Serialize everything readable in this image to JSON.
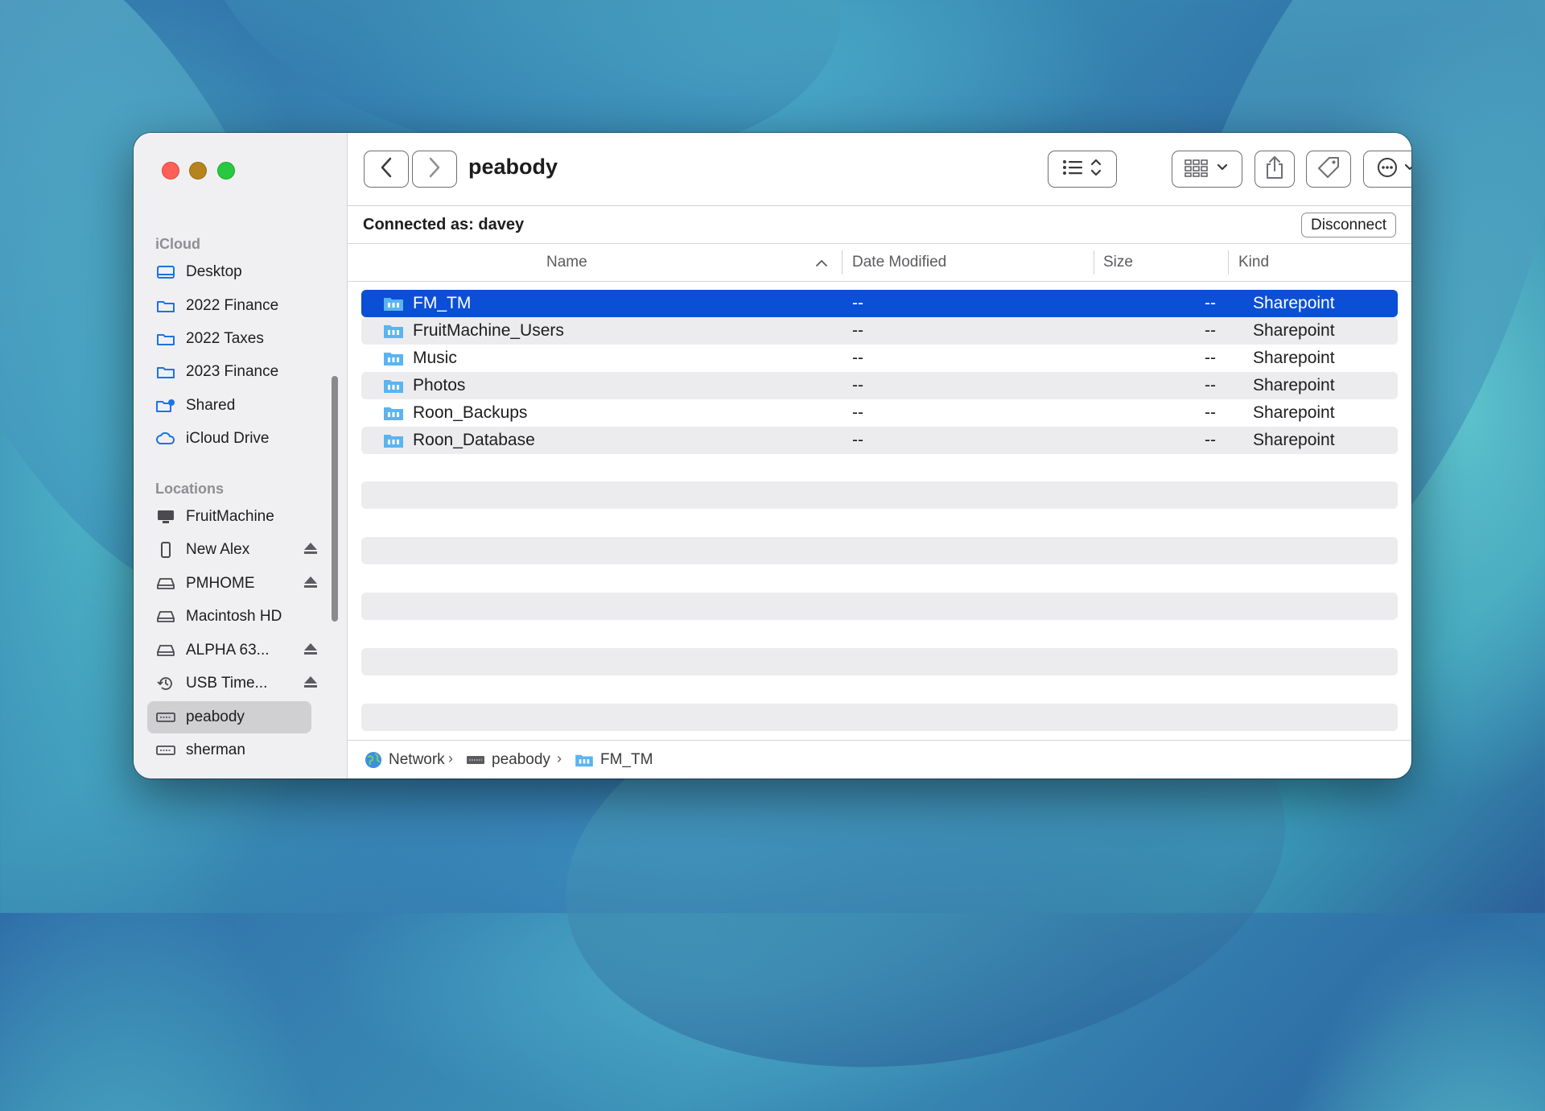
{
  "window": {
    "title": "peabody"
  },
  "sidebar": {
    "icloud_header": "iCloud",
    "icloud_items": [
      {
        "label": "Desktop",
        "icon": "desktop-icon"
      },
      {
        "label": "2022 Finance",
        "icon": "folder-icon"
      },
      {
        "label": "2022 Taxes",
        "icon": "folder-icon"
      },
      {
        "label": "2023 Finance",
        "icon": "folder-icon"
      },
      {
        "label": "Shared",
        "icon": "shared-folder-icon"
      },
      {
        "label": "iCloud Drive",
        "icon": "cloud-icon"
      }
    ],
    "locations_header": "Locations",
    "location_items": [
      {
        "label": "FruitMachine",
        "icon": "computer-icon",
        "eject": false
      },
      {
        "label": "New Alex",
        "icon": "phone-icon",
        "eject": true
      },
      {
        "label": "PMHOME",
        "icon": "drive-icon",
        "eject": true
      },
      {
        "label": "Macintosh HD",
        "icon": "drive-icon",
        "eject": false
      },
      {
        "label": "ALPHA 63...",
        "icon": "drive-icon",
        "eject": true
      },
      {
        "label": "USB Time...",
        "icon": "time-machine-icon",
        "eject": true
      },
      {
        "label": "peabody",
        "icon": "server-icon",
        "eject": false,
        "selected": true
      },
      {
        "label": "sherman",
        "icon": "server-icon",
        "eject": false
      }
    ]
  },
  "toolbar": {
    "back": "back-chevron-icon",
    "forward": "forward-chevron-icon",
    "view_mode": "list-view-icon",
    "group": "group-grid-icon",
    "share": "share-icon",
    "tag": "tag-icon",
    "more": "ellipsis-circle-icon",
    "search": "search-icon"
  },
  "connection": {
    "status": "Connected as: davey",
    "disconnect_label": "Disconnect"
  },
  "columns": {
    "name": "Name",
    "date": "Date Modified",
    "size": "Size",
    "kind": "Kind"
  },
  "files": [
    {
      "name": "FM_TM",
      "date": "--",
      "size": "--",
      "kind": "Sharepoint",
      "selected": true
    },
    {
      "name": "FruitMachine_Users",
      "date": "--",
      "size": "--",
      "kind": "Sharepoint"
    },
    {
      "name": "Music",
      "date": "--",
      "size": "--",
      "kind": "Sharepoint"
    },
    {
      "name": "Photos",
      "date": "--",
      "size": "--",
      "kind": "Sharepoint"
    },
    {
      "name": "Roon_Backups",
      "date": "--",
      "size": "--",
      "kind": "Sharepoint"
    },
    {
      "name": "Roon_Database",
      "date": "--",
      "size": "--",
      "kind": "Sharepoint"
    }
  ],
  "pathbar": [
    {
      "label": "Network",
      "icon": "globe-icon"
    },
    {
      "label": "peabody",
      "icon": "server-icon"
    },
    {
      "label": "FM_TM",
      "icon": "shared-folder-icon"
    }
  ],
  "colors": {
    "selection": "#0a4fd6",
    "folder": "#5ab4f2",
    "close": "#fe5f57",
    "minimize": "#b5841f",
    "maximize": "#28c840"
  }
}
